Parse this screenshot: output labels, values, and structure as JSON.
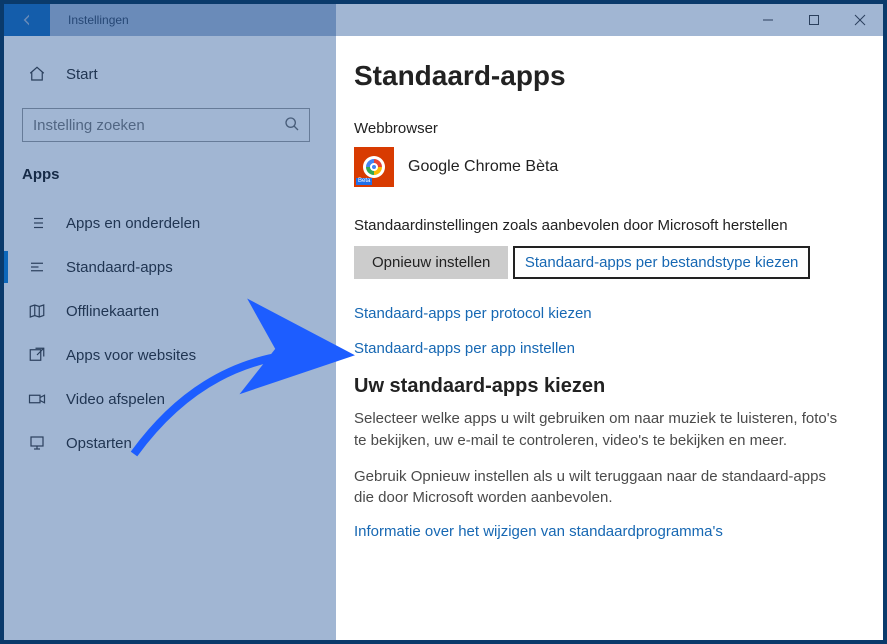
{
  "titlebar": {
    "app_title": "Instellingen"
  },
  "sidebar": {
    "home_label": "Start",
    "search_placeholder": "Instelling zoeken",
    "section_label": "Apps",
    "items": [
      {
        "label": "Apps en onderdelen"
      },
      {
        "label": "Standaard-apps"
      },
      {
        "label": "Offlinekaarten"
      },
      {
        "label": "Apps voor websites"
      },
      {
        "label": "Video afspelen"
      },
      {
        "label": "Opstarten"
      }
    ]
  },
  "main": {
    "title": "Standaard-apps",
    "browser_label": "Webbrowser",
    "browser_app_name": "Google Chrome Bèta",
    "reset_description": "Standaardinstellingen zoals aanbevolen door Microsoft herstellen",
    "reset_button": "Opnieuw instellen",
    "link_by_filetype": "Standaard-apps per bestandstype kiezen",
    "link_by_protocol": "Standaard-apps per protocol kiezen",
    "link_by_app": "Standaard-apps per app instellen",
    "choose_title": "Uw standaard-apps kiezen",
    "choose_p1": "Selecteer welke apps u wilt gebruiken om naar muziek te luisteren, foto's te bekijken, uw e-mail te controleren, video's te bekijken en meer.",
    "choose_p2": "Gebruik Opnieuw instellen als u wilt teruggaan naar de standaard-apps die door Microsoft worden aanbevolen.",
    "info_link": "Informatie over het wijzigen van standaardprogramma's"
  }
}
